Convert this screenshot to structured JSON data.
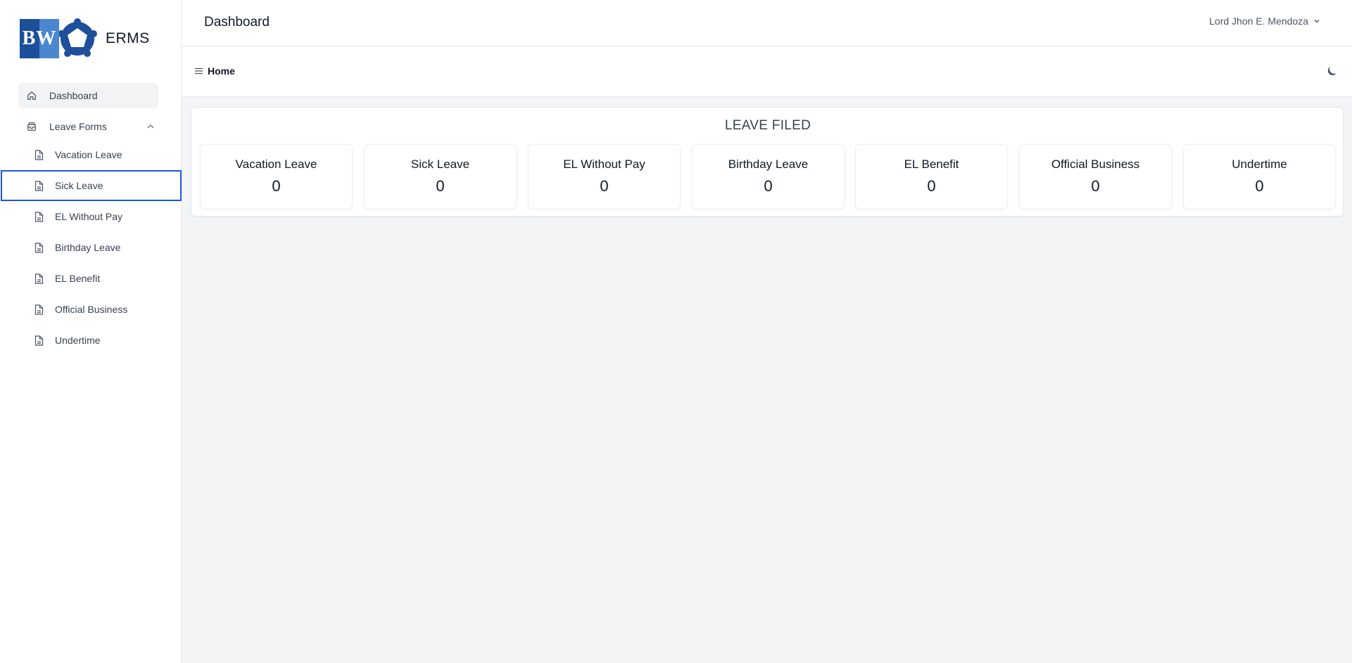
{
  "app": {
    "logo_text": "BW",
    "name": "ERMS"
  },
  "sidebar": {
    "dashboard_label": "Dashboard",
    "leave_forms_label": "Leave Forms",
    "leave_forms_items": [
      {
        "label": "Vacation Leave"
      },
      {
        "label": "Sick Leave"
      },
      {
        "label": "EL Without Pay"
      },
      {
        "label": "Birthday Leave"
      },
      {
        "label": "EL Benefit"
      },
      {
        "label": "Official Business"
      },
      {
        "label": "Undertime"
      }
    ]
  },
  "header": {
    "title": "Dashboard",
    "user_name": "Lord Jhon E. Mendoza"
  },
  "breadcrumb": {
    "current": "Home"
  },
  "leave_filed": {
    "title": "LEAVE FILED",
    "stats": [
      {
        "label": "Vacation Leave",
        "value": "0"
      },
      {
        "label": "Sick Leave",
        "value": "0"
      },
      {
        "label": "EL Without Pay",
        "value": "0"
      },
      {
        "label": "Birthday Leave",
        "value": "0"
      },
      {
        "label": "EL Benefit",
        "value": "0"
      },
      {
        "label": "Official Business",
        "value": "0"
      },
      {
        "label": "Undertime",
        "value": "0"
      }
    ]
  },
  "colors": {
    "selection_outline": "#1a56db",
    "logo_dark": "#1d4f9a",
    "logo_light": "#4b87cf"
  }
}
